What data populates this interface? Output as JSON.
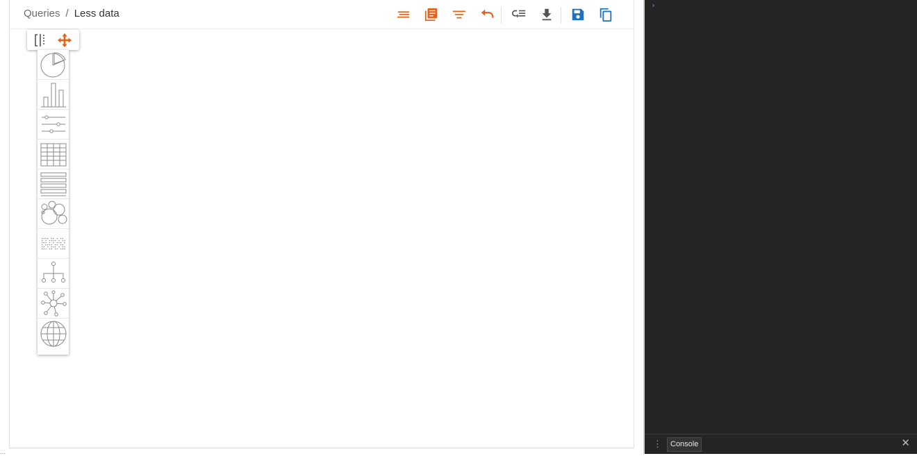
{
  "breadcrumb": {
    "parent": "Queries",
    "separator": "/",
    "current": "Less data"
  },
  "toolbar": {
    "buttons": [
      {
        "name": "format-icon",
        "color": "#e0661f"
      },
      {
        "name": "notes-icon",
        "color": "#e0661f"
      },
      {
        "name": "filter-icon",
        "color": "#e0661f"
      },
      {
        "name": "undo-icon",
        "color": "#e0661f"
      },
      {
        "name": "wrap-list-icon",
        "color": "#555555"
      },
      {
        "name": "download-icon",
        "color": "#555555"
      },
      {
        "name": "save-icon",
        "color": "#1e73be"
      },
      {
        "name": "copy-icon",
        "color": "#1e73be"
      }
    ]
  },
  "palette": {
    "top_buttons": [
      "split-view-icon",
      "move-icon"
    ],
    "items": [
      "pie-chart-icon",
      "bar-chart-icon",
      "sliders-icon",
      "table-icon",
      "list-icon",
      "bubble-chart-icon",
      "dot-matrix-icon",
      "tree-icon",
      "network-icon",
      "globe-icon"
    ]
  },
  "devtools": {
    "prompt": "›",
    "tab_label": "Console",
    "close": "✕",
    "menu": "⋮"
  },
  "status_text": "...",
  "colors": {
    "accent_orange": "#e0661f",
    "accent_blue": "#1e73be",
    "console_bg": "#242424"
  }
}
